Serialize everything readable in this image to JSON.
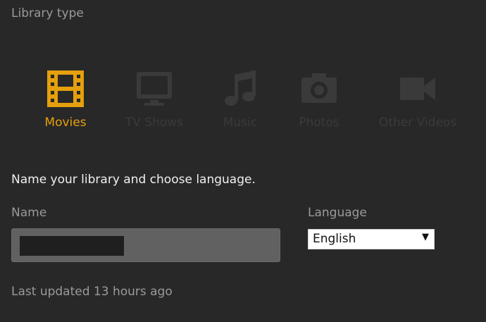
{
  "section_title": "Library type",
  "library_types": [
    {
      "label": "Movies",
      "icon": "film-icon",
      "active": true
    },
    {
      "label": "TV Shows",
      "icon": "tv-icon",
      "active": false
    },
    {
      "label": "Music",
      "icon": "music-note-icon",
      "active": false
    },
    {
      "label": "Photos",
      "icon": "camera-icon",
      "active": false
    },
    {
      "label": "Other Videos",
      "icon": "video-camera-icon",
      "active": false
    }
  ],
  "prompt": "Name your library and choose language.",
  "name_field": {
    "label": "Name",
    "value": ""
  },
  "language_field": {
    "label": "Language",
    "selected": "English"
  },
  "last_updated": "Last updated 13 hours ago",
  "colors": {
    "accent": "#e5a00d",
    "inactive": "#3a3a3a",
    "background": "#282828"
  }
}
